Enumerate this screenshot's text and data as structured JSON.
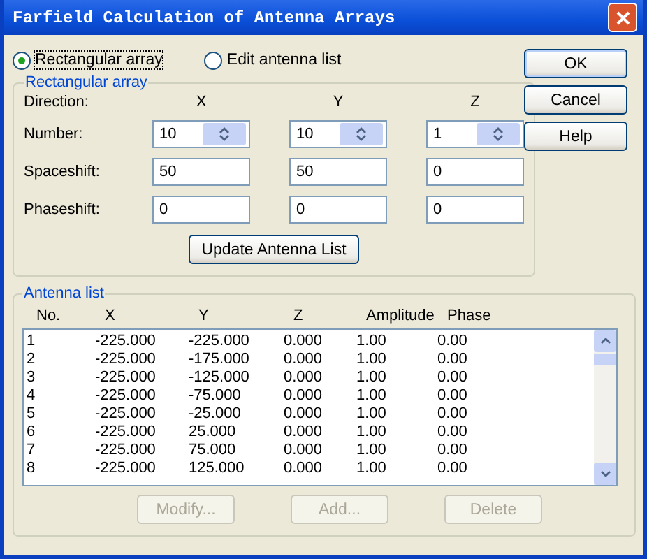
{
  "window": {
    "title": "Farfield Calculation of Antenna Arrays"
  },
  "mode_options": [
    {
      "label": "Rectangular array",
      "selected": true
    },
    {
      "label": "Edit antenna list",
      "selected": false
    }
  ],
  "dialog_buttons": [
    {
      "label": "OK",
      "default": true
    },
    {
      "label": "Cancel",
      "default": false
    },
    {
      "label": "Help",
      "default": false
    }
  ],
  "rectangular_array": {
    "title": "Rectangular array",
    "direction_label": "Direction:",
    "axes": [
      "X",
      "Y",
      "Z"
    ],
    "rows": [
      {
        "label": "Number:",
        "kind": "spin",
        "values": [
          "10",
          "10",
          "1"
        ]
      },
      {
        "label": "Spaceshift:",
        "kind": "text",
        "values": [
          "50",
          "50",
          "0"
        ]
      },
      {
        "label": "Phaseshift:",
        "kind": "text",
        "values": [
          "0",
          "0",
          "0"
        ]
      }
    ],
    "update_button": "Update Antenna List"
  },
  "antenna_list": {
    "title": "Antenna list",
    "columns": [
      "No.",
      "X",
      "Y",
      "Z",
      "Amplitude",
      "Phase"
    ],
    "rows": [
      [
        "1",
        "-225.000",
        "-225.000",
        "0.000",
        "1.00",
        "0.00"
      ],
      [
        "2",
        "-225.000",
        "-175.000",
        "0.000",
        "1.00",
        "0.00"
      ],
      [
        "3",
        "-225.000",
        "-125.000",
        "0.000",
        "1.00",
        "0.00"
      ],
      [
        "4",
        "-225.000",
        "-75.000",
        "0.000",
        "1.00",
        "0.00"
      ],
      [
        "5",
        "-225.000",
        "-25.000",
        "0.000",
        "1.00",
        "0.00"
      ],
      [
        "6",
        "-225.000",
        "25.000",
        "0.000",
        "1.00",
        "0.00"
      ],
      [
        "7",
        "-225.000",
        "75.000",
        "0.000",
        "1.00",
        "0.00"
      ],
      [
        "8",
        "-225.000",
        "125.000",
        "0.000",
        "1.00",
        "0.00"
      ]
    ],
    "buttons": [
      {
        "label": "Modify...",
        "disabled": true
      },
      {
        "label": "Add...",
        "disabled": true
      },
      {
        "label": "Delete",
        "disabled": true
      }
    ]
  }
}
